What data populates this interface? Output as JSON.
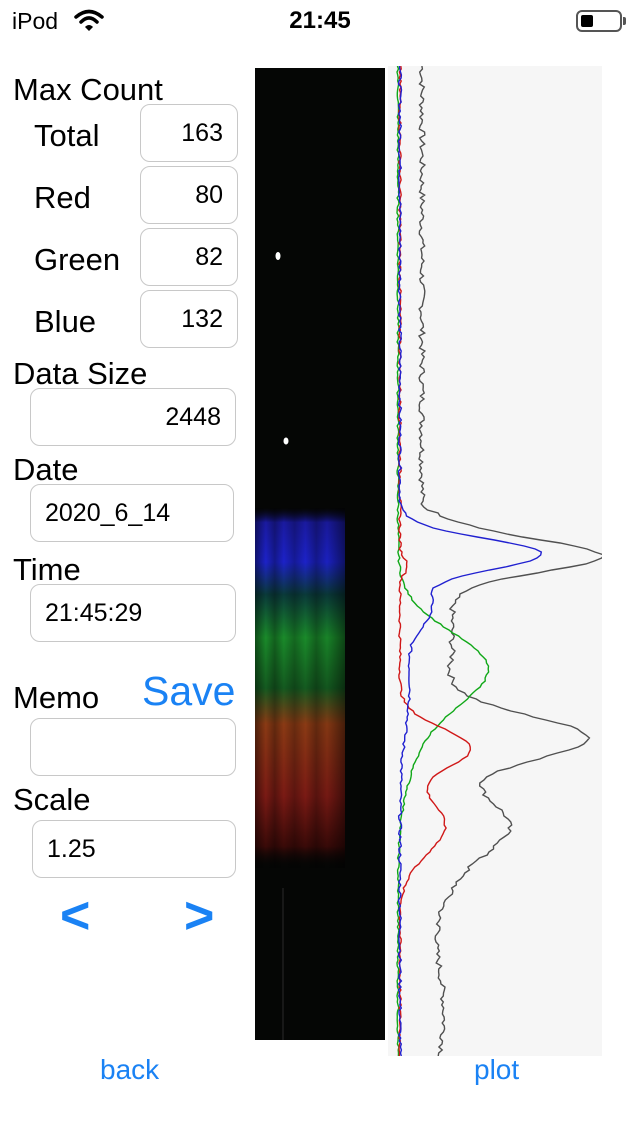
{
  "status_bar": {
    "carrier": "iPod",
    "time": "21:45"
  },
  "max_count": {
    "heading": "Max Count",
    "total": {
      "label": "Total",
      "value": "163"
    },
    "red": {
      "label": "Red",
      "value": "80"
    },
    "green": {
      "label": "Green",
      "value": "82"
    },
    "blue": {
      "label": "Blue",
      "value": "132"
    }
  },
  "data_size": {
    "label": "Data Size",
    "value": "2448"
  },
  "date": {
    "label": "Date",
    "value": "2020_6_14"
  },
  "time": {
    "label": "Time",
    "value": "21:45:29"
  },
  "memo": {
    "label": "Memo",
    "value": ""
  },
  "save_label": "Save",
  "scale": {
    "label": "Scale",
    "value": "1.25"
  },
  "nav": {
    "prev": "<",
    "next": ">"
  },
  "bottom": {
    "back": "back",
    "plot": "plot"
  },
  "colors": {
    "accent": "#1a82f4",
    "red_line": "#d01818",
    "green_line": "#10a818",
    "blue_line": "#2020d0",
    "total_line": "#505050"
  }
}
